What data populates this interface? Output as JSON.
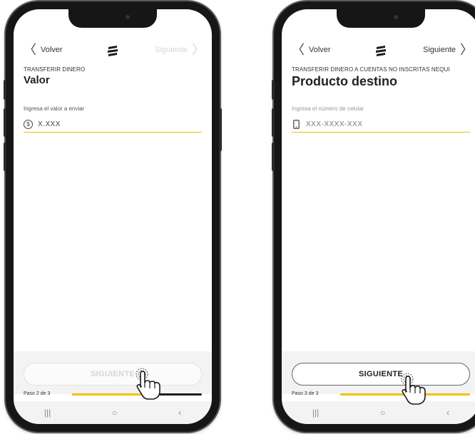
{
  "screens": [
    {
      "back_label": "Volver",
      "next_label": "Siguiente",
      "next_enabled": false,
      "eyebrow": "TRANSFERIR DINERO",
      "title": "Valor",
      "field_label": "Ingresa el valor a enviar",
      "field_value": "X.XXX",
      "field_icon": "dollar-coin-icon",
      "cta_label": "SIGUIENTE",
      "cta_enabled": false,
      "step_text": "Paso 2 de 3",
      "progress": 0.67
    },
    {
      "back_label": "Volver",
      "next_label": "Siguiente",
      "next_enabled": true,
      "eyebrow": "TRANSFERIR DINERO A CUENTAS NO INSCRITAS NEQUI",
      "title": "Producto destino",
      "field_label": "Ingresa el número de celular",
      "field_value": "XXX-XXXX-XXX",
      "field_icon": "mobile-phone-icon",
      "cta_label": "SIGUIENTE",
      "cta_enabled": true,
      "step_text": "Paso 3 de 3",
      "progress": 1.0
    }
  ],
  "colors": {
    "accent": "#f2c200",
    "phone_frame": "#161616",
    "disabled_text": "#d5d5d5"
  },
  "system_nav": {
    "recents": "|||",
    "home": "○",
    "back": "‹"
  }
}
